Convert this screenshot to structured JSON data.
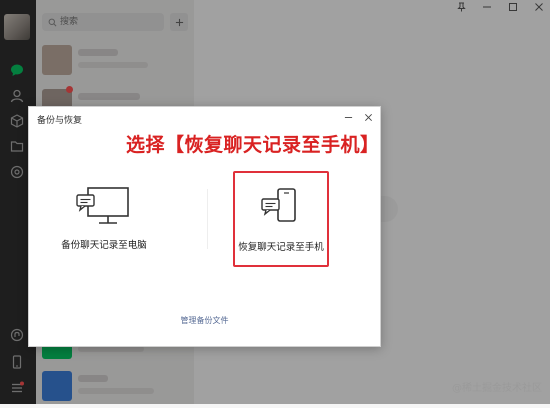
{
  "search": {
    "placeholder": "搜索"
  },
  "chat_list": {
    "items": [
      {
        "name": ""
      },
      {
        "name": ""
      },
      {
        "name": ""
      },
      {
        "name": ""
      },
      {
        "name": ""
      },
      {
        "name": ""
      },
      {
        "name": ""
      },
      {
        "name": ""
      }
    ]
  },
  "dialog": {
    "title": "备份与恢复",
    "option_backup_label": "备份聊天记录至电脑",
    "option_restore_label": "恢复聊天记录至手机",
    "manage_link": "管理备份文件"
  },
  "annotation": {
    "text": "选择【恢复聊天记录至手机】"
  },
  "watermark": {
    "text": "@稀土掘金技术社区"
  },
  "colors": {
    "accent_green": "#07c160",
    "highlight_red": "#e0303a",
    "annotation_red": "#d92222",
    "link_blue": "#576b95"
  },
  "icons": {
    "rail": [
      "chat-icon",
      "contacts-icon",
      "favorites-icon",
      "files-icon",
      "moments-icon",
      "miniprogram-icon",
      "phone-icon",
      "menu-icon"
    ],
    "window": [
      "pin-icon",
      "minimize-icon",
      "maximize-icon",
      "close-icon"
    ]
  }
}
